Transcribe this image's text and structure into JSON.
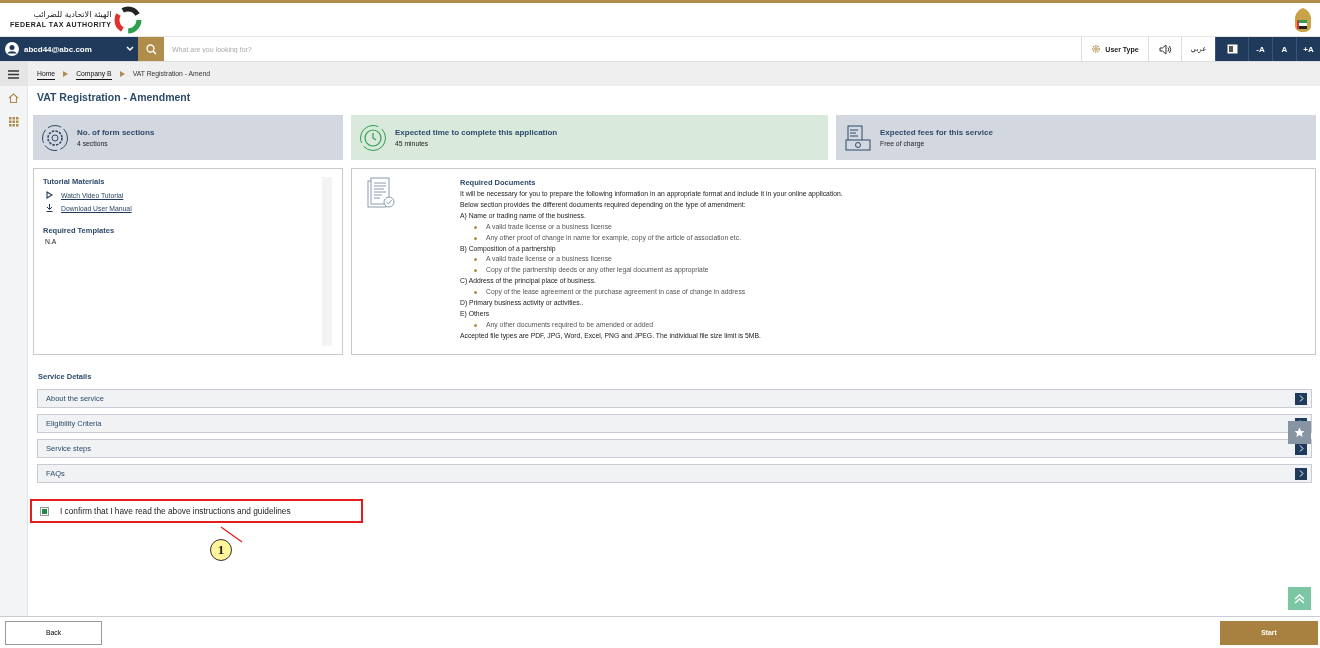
{
  "header": {
    "logo_arabic": "الهيئة الاتحادية للضرائب",
    "logo_english": "FEDERAL TAX AUTHORITY"
  },
  "toolbar": {
    "user": "abcd44@abc.com",
    "search": {
      "placeholder": "What are you looking for?"
    },
    "user_type": "User Type",
    "language": "عربي",
    "font_buttons": [
      "-A",
      "A",
      "+A"
    ]
  },
  "breadcrumb": [
    {
      "label": "Home",
      "link": true
    },
    {
      "label": "Company B",
      "link": true
    },
    {
      "label": "VAT Registration - Amend",
      "link": false
    }
  ],
  "page_title": "VAT Registration - Amendment",
  "info_cards": [
    {
      "kind": "sections",
      "title": "No. of form sections",
      "value": "4 sections",
      "color": "#d3d7df"
    },
    {
      "kind": "time",
      "title": "Expected time to complete this application",
      "value": "45 minutes",
      "color": "#d9eadd"
    },
    {
      "kind": "fees",
      "title": "Expected fees for this service",
      "value": "Free of charge",
      "color": "#d3d7df"
    }
  ],
  "tutorial": {
    "title": "Tutorial Materials",
    "links": [
      {
        "kind": "video",
        "label": "Watch Video Tutorial"
      },
      {
        "kind": "download",
        "label": "Download User Manual"
      }
    ],
    "templates_title": "Required Templates",
    "templates": "N.A"
  },
  "required_documents": {
    "title": "Required Documents",
    "intro": [
      "It will be necessary for you to prepare the following information in an appropriate format and include it in your online application.",
      "Below section provides the different documents required depending on the type of amendment:"
    ],
    "groups": [
      {
        "heading": "A) Name or trading name of the business.",
        "items": [
          "A valid trade license or a business license",
          "Any other proof of change in name for example, copy of the article of association etc."
        ]
      },
      {
        "heading": "B) Composition of a partnership",
        "items": [
          "A valid trade license or a business license",
          "Copy of the partnership deeds or any other legal document as appropriate"
        ]
      },
      {
        "heading": "C) Address of the principal place of business.",
        "items": [
          "Copy of the lease agreement or the purchase agreement in case of change in address"
        ]
      },
      {
        "heading": "D) Primary business activity or activities.."
      },
      {
        "heading": "E) Others",
        "items": [
          "Any other documents required to be amended or added"
        ]
      }
    ],
    "footer": "Accepted file types are PDF, JPG, Word, Excel, PNG and JPEG. The individual file size limit is 5MB."
  },
  "service_details": {
    "title": "Service Details",
    "sections": [
      "About the service",
      "Eligibility Criteria",
      "Service steps",
      "FAQs"
    ]
  },
  "confirmation": {
    "label": "I confirm that I have read the above instructions and guidelines",
    "checked": true
  },
  "callout": "1",
  "footer": {
    "back": "Back",
    "start": "Start"
  }
}
